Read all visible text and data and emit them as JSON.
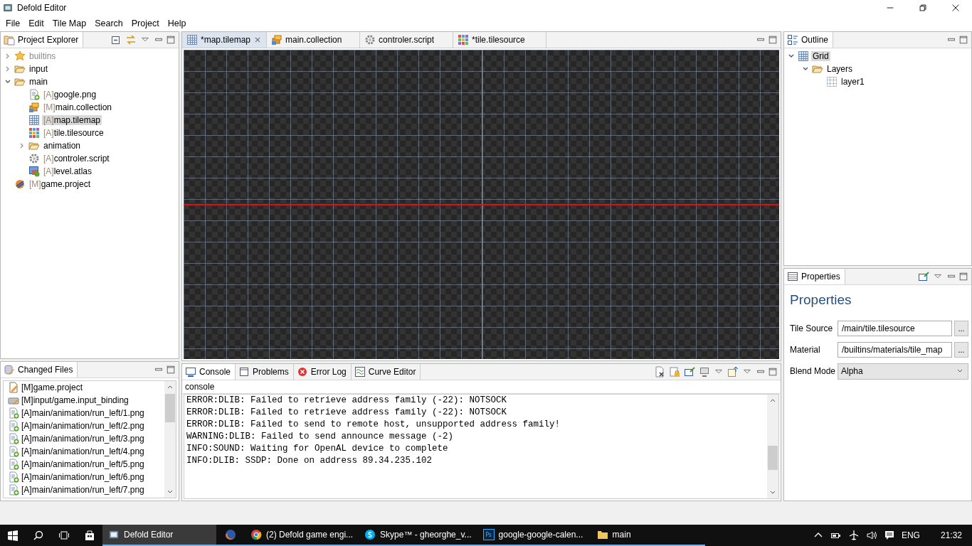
{
  "window": {
    "title": "Defold Editor"
  },
  "menu": [
    "File",
    "Edit",
    "Tile Map",
    "Search",
    "Project",
    "Help"
  ],
  "project_explorer": {
    "title": "Project Explorer",
    "tree": [
      {
        "name": "builtins",
        "kind": "builtins",
        "expanded": false,
        "disabled": true,
        "selected": false
      },
      {
        "name": "input",
        "kind": "folder",
        "expanded": false,
        "disabled": false,
        "selected": false
      },
      {
        "name": "main",
        "kind": "folder",
        "expanded": true,
        "disabled": false,
        "selected": false,
        "children": [
          {
            "prefix": "[A]",
            "name": "google.png",
            "kind": "image",
            "disabled": false,
            "selected": false
          },
          {
            "prefix": "[M]",
            "name": "main.collection",
            "kind": "collection",
            "disabled": false,
            "selected": false
          },
          {
            "prefix": "[A]",
            "name": "map.tilemap",
            "kind": "tilemap",
            "disabled": false,
            "selected": true
          },
          {
            "prefix": "[A]",
            "name": "tile.tilesource",
            "kind": "tilesource",
            "disabled": false,
            "selected": false
          },
          {
            "name": "animation",
            "kind": "folder",
            "expanded": false,
            "disabled": false,
            "selected": false
          },
          {
            "prefix": "[A]",
            "name": "controler.script",
            "kind": "script",
            "disabled": false,
            "selected": false
          },
          {
            "prefix": "[A]",
            "name": "level.atlas",
            "kind": "atlas",
            "disabled": false,
            "selected": false
          }
        ]
      },
      {
        "prefix": "[M]",
        "name": "game.project",
        "kind": "project",
        "disabled": false,
        "selected": false
      }
    ]
  },
  "changed_files": {
    "title": "Changed Files",
    "items": [
      {
        "text": "[M]game.project",
        "kind": "modified"
      },
      {
        "text": "[M]input/game.input_binding",
        "kind": "input"
      },
      {
        "text": "[A]main/animation/run_left/1.png",
        "kind": "added"
      },
      {
        "text": "[A]main/animation/run_left/2.png",
        "kind": "added"
      },
      {
        "text": "[A]main/animation/run_left/3.png",
        "kind": "added"
      },
      {
        "text": "[A]main/animation/run_left/4.png",
        "kind": "added"
      },
      {
        "text": "[A]main/animation/run_left/5.png",
        "kind": "added"
      },
      {
        "text": "[A]main/animation/run_left/6.png",
        "kind": "added"
      },
      {
        "text": "[A]main/animation/run_left/7.png",
        "kind": "added"
      }
    ]
  },
  "editor_tabs": [
    {
      "label": "*map.tilemap",
      "kind": "tilemap",
      "selected": true
    },
    {
      "label": "main.collection",
      "kind": "collection",
      "selected": false
    },
    {
      "label": "controler.script",
      "kind": "script",
      "selected": false
    },
    {
      "label": "*tile.tilesource",
      "kind": "tilesource",
      "selected": false
    }
  ],
  "console": {
    "tabs": [
      {
        "label": "Console",
        "kind": "console",
        "selected": true
      },
      {
        "label": "Problems",
        "kind": "problems",
        "selected": false
      },
      {
        "label": "Error Log",
        "kind": "errorlog",
        "selected": false
      },
      {
        "label": "Curve Editor",
        "kind": "curve",
        "selected": false
      }
    ],
    "name": "console",
    "lines": [
      "ERROR:DLIB: Failed to retrieve address family (-22): NOTSOCK",
      "ERROR:DLIB: Failed to retrieve address family (-22): NOTSOCK",
      "ERROR:DLIB: Failed to send to remote host, unsupported address family!",
      "WARNING:DLIB: Failed to send announce message (-2)",
      "INFO:SOUND: Waiting for OpenAL device to complete",
      "INFO:DLIB: SSDP: Done on address 89.34.235.102"
    ]
  },
  "outline": {
    "title": "Outline",
    "tree": [
      {
        "name": "Grid",
        "kind": "grid",
        "expanded": true,
        "selected": true,
        "children": [
          {
            "name": "Layers",
            "kind": "folder",
            "expanded": true,
            "selected": false,
            "children": [
              {
                "name": "layer1",
                "kind": "layer",
                "selected": false
              }
            ]
          }
        ]
      }
    ]
  },
  "properties": {
    "tab": "Properties",
    "heading": "Properties",
    "fields": [
      {
        "label": "Tile Source",
        "value": "/main/tile.tilesource",
        "kind": "browse",
        "button": "..."
      },
      {
        "label": "Material",
        "value": "/builtins/materials/tile_map",
        "kind": "browse",
        "button": "..."
      },
      {
        "label": "Blend Mode",
        "value": "Alpha",
        "kind": "select"
      }
    ]
  },
  "taskbar": {
    "apps": [
      {
        "label": "Defold Editor",
        "kind": "defold",
        "selected": true
      },
      {
        "kind": "firefox",
        "selected": false
      },
      {
        "label": "(2) Defold game engi...",
        "kind": "chrome",
        "selected": false
      },
      {
        "label": "Skype™ - gheorghe_v...",
        "kind": "skype",
        "selected": false
      },
      {
        "label": "google-google-calen...",
        "kind": "photoshop",
        "icon_text": "Ps",
        "selected": false
      },
      {
        "label": "main",
        "kind": "folder",
        "selected": false
      }
    ],
    "language": "ENG",
    "time": "21:32"
  }
}
